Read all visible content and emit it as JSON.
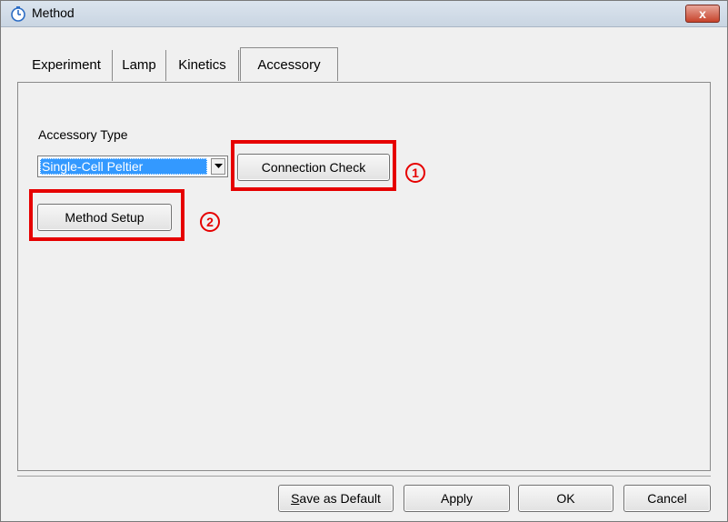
{
  "window": {
    "title": "Method",
    "close_symbol": "x"
  },
  "tabs": [
    {
      "label": "Experiment",
      "active": false
    },
    {
      "label": "Lamp",
      "active": false
    },
    {
      "label": "Kinetics",
      "active": false
    },
    {
      "label": "Accessory",
      "active": true
    }
  ],
  "accessory": {
    "type_label": "Accessory Type",
    "type_value": "Single-Cell Peltier",
    "connection_check_label": "Connection Check",
    "method_setup_label": "Method Setup"
  },
  "annotations": {
    "marker_1": "1",
    "marker_2": "2",
    "highlight_color": "#e60000"
  },
  "footer": {
    "save_default_mnemonic": "S",
    "save_default_rest": "ave as Default",
    "apply_label": "Apply",
    "ok_label": "OK",
    "cancel_label": "Cancel"
  },
  "icons": {
    "title_icon": "timer-icon",
    "dropdown_icon": "chevron-down-icon",
    "close_icon": "close-icon"
  }
}
